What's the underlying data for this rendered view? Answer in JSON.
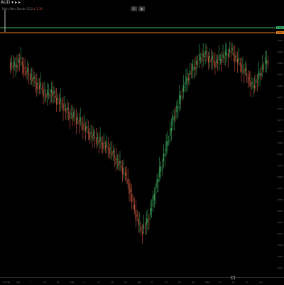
{
  "header": {
    "symbol": "AUD ▾ ▸ ▸",
    "study_label": "Bolly Ntrv Bands 10,2",
    "study_value": "▸ 1.10",
    "buttons": [
      "⊞",
      "▣"
    ]
  },
  "price_tags": {
    "upper_value": "0.694",
    "lower_value": "0.690",
    "upper_color": "#3cb371",
    "lower_color": "#e8821c"
  },
  "price_axis_labels": [
    "0.692",
    "0.689",
    "0.686",
    "0.683",
    "0.680",
    "0.677",
    "0.674",
    "0.671",
    "0.668",
    "0.665",
    "0.662",
    "0.659",
    "0.656",
    "0.653",
    "0.650",
    "0.647",
    "0.644",
    "0.641",
    "0.638",
    "0.635",
    "0.632"
  ],
  "time_axis_labels": [
    "14-Feb",
    "Mar",
    "7",
    "14",
    "21",
    "Mar",
    "4",
    "11",
    "18",
    "25",
    "Apr",
    "8",
    "15",
    "22",
    "29",
    "May",
    "13",
    "20",
    "27",
    "Jun"
  ],
  "colors": {
    "up": "#3aa75a",
    "down": "#c8563f",
    "level_line_upper": "#3cb371",
    "level_line_lower": "#e8821c",
    "background": "#000000"
  },
  "chart_data": {
    "type": "candlestick",
    "series": [
      {
        "values": [
          0.687,
          0.686,
          0.688,
          0.685,
          0.684,
          0.682,
          0.681,
          0.679,
          0.68,
          0.678,
          0.677,
          0.675,
          0.674,
          0.673,
          0.672,
          0.67,
          0.669,
          0.668,
          0.667,
          0.666,
          0.664,
          0.662,
          0.66,
          0.655,
          0.65,
          0.646,
          0.648,
          0.652,
          0.658,
          0.663,
          0.668,
          0.673,
          0.677,
          0.681,
          0.684,
          0.686,
          0.688,
          0.689,
          0.688,
          0.687,
          0.688,
          0.689,
          0.69,
          0.688,
          0.686,
          0.684,
          0.681,
          0.683,
          0.686,
          0.688
        ]
      }
    ]
  }
}
